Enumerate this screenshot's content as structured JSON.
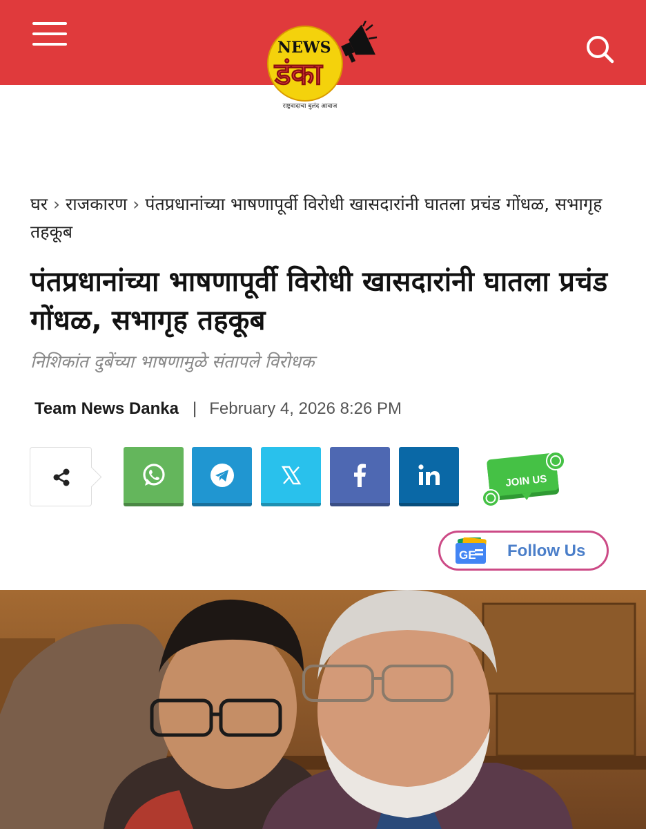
{
  "header": {
    "logo_news": "NEWS",
    "logo_danka": "डंका",
    "logo_tagline": "राष्ट्रवादाचा बुलंद आवाज",
    "menu_icon": "hamburger-menu-icon",
    "search_icon": "search-icon",
    "bg_color": "#e03a3c"
  },
  "breadcrumb": {
    "items": [
      "घर",
      "राजकारण",
      "पंतप्रधानांच्या भाषणापूर्वी विरोधी खासदारांनी घातला प्रचंड गोंधळ, सभागृह तहकूब"
    ],
    "separator": "›"
  },
  "article": {
    "headline": "पंतप्रधानांच्या भाषणापूर्वी विरोधी खासदारांनी घातला प्रचंड गोंधळ, सभागृह तहकूब",
    "subtitle": "निशिकांत दुबेंच्या भाषणामुळे संतापले विरोधक",
    "author": "Team News Danka",
    "meta_divider": "|",
    "date": "February 4, 2026 8:26 PM"
  },
  "share": {
    "share_icon": "share-icon",
    "buttons": [
      {
        "icon": "whatsapp-icon",
        "color": "#64b65c"
      },
      {
        "icon": "telegram-icon",
        "color": "#2096d1"
      },
      {
        "icon": "x-icon",
        "color": "#29c1ec"
      },
      {
        "icon": "facebook-icon",
        "color": "#4e68b2"
      },
      {
        "icon": "linkedin-icon",
        "color": "#0a68a6"
      }
    ],
    "join_label": "JOIN US",
    "follow_label": "Follow Us",
    "follow_badge": "GE"
  }
}
